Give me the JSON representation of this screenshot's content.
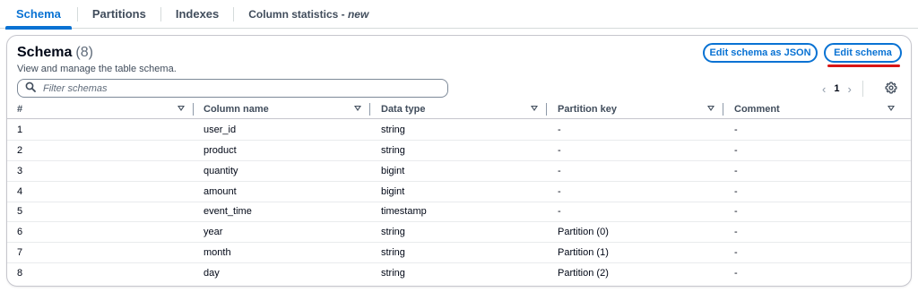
{
  "tabs": [
    {
      "label": "Schema",
      "active": true
    },
    {
      "label": "Partitions",
      "active": false
    },
    {
      "label": "Indexes",
      "active": false
    },
    {
      "label": "Column statistics - ",
      "suffix": "new",
      "active": false
    }
  ],
  "header": {
    "title": "Schema",
    "count": "(8)",
    "description": "View and manage the table schema.",
    "edit_json_label": "Edit schema as JSON",
    "edit_label": "Edit schema"
  },
  "search": {
    "placeholder": "Filter schemas"
  },
  "pagination": {
    "current_page": "1",
    "prev": "‹",
    "next": "›"
  },
  "table": {
    "columns": [
      "#",
      "Column name",
      "Data type",
      "Partition key",
      "Comment"
    ],
    "rows": [
      [
        "1",
        "user_id",
        "string",
        "-",
        "-"
      ],
      [
        "2",
        "product",
        "string",
        "-",
        "-"
      ],
      [
        "3",
        "quantity",
        "bigint",
        "-",
        "-"
      ],
      [
        "4",
        "amount",
        "bigint",
        "-",
        "-"
      ],
      [
        "5",
        "event_time",
        "timestamp",
        "-",
        "-"
      ],
      [
        "6",
        "year",
        "string",
        "Partition (0)",
        "-"
      ],
      [
        "7",
        "month",
        "string",
        "Partition (1)",
        "-"
      ],
      [
        "8",
        "day",
        "string",
        "Partition (2)",
        "-"
      ]
    ]
  },
  "icons": {
    "search": "search-icon",
    "settings": "gear-icon",
    "sort": "sort-caret-icon"
  },
  "colors": {
    "accent": "#0972d3",
    "highlight": "#d91515",
    "text": "#000716"
  }
}
